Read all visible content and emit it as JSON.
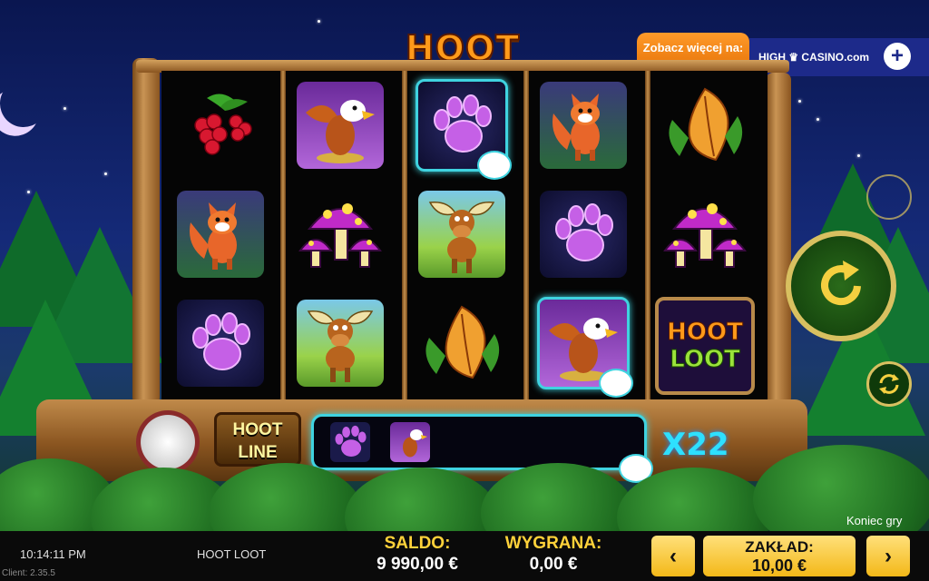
{
  "game": {
    "logo_word1": "HOOT",
    "logo_word2": "LOOT",
    "hoot_line": "HOOT LINE",
    "multiplier": "X22",
    "end_game": "Koniec gry"
  },
  "reels": [
    [
      "raspberry",
      "fox",
      "paw-print"
    ],
    [
      "eagle",
      "mushrooms",
      "moose"
    ],
    [
      "paw-print",
      "moose",
      "leaf"
    ],
    [
      "fox",
      "paw-print",
      "eagle"
    ],
    [
      "leaf",
      "mushrooms",
      "hoot-loot-logo"
    ]
  ],
  "hoot_line_symbols": [
    "paw-print",
    "eagle"
  ],
  "promo": {
    "text": "Zobacz więcej na:",
    "brand": "HIGH ♛ CASINO.com",
    "plus": "+"
  },
  "status_bar": {
    "time": "10:14:11 PM",
    "client": "Client: 2.35.5",
    "game_name": "HOOT LOOT",
    "balance_label": "SALDO:",
    "balance_value": "9 990,00 €",
    "win_label": "WYGRANA:",
    "win_value": "0,00 €",
    "stake_label": "ZAKŁAD:",
    "stake_value": "10,00 €",
    "prev": "‹",
    "next": "›"
  },
  "colors": {
    "accent_cyan": "#3fd3e0",
    "gold": "#ffd23a",
    "promo_orange": "#ff9a2a"
  }
}
